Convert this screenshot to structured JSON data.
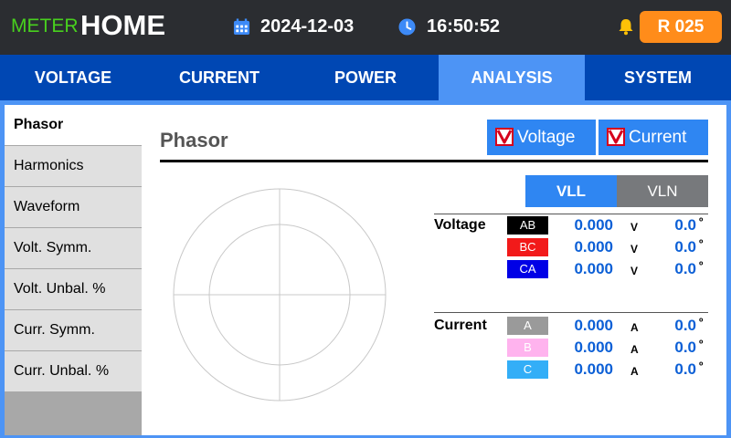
{
  "header": {
    "brand_small": "METER",
    "brand_large": "HOME",
    "date": "2024-12-03",
    "time": "16:50:52",
    "badge": "R 025",
    "icons": [
      "calendar-icon",
      "clock-icon",
      "bell-icon"
    ],
    "colors": {
      "bar": "#2b2d31",
      "brand_small": "#48d01e",
      "badge": "#ff8c1a",
      "bell": "#ffc107"
    }
  },
  "tabs": [
    {
      "label": "VOLTAGE",
      "active": false
    },
    {
      "label": "CURRENT",
      "active": false
    },
    {
      "label": "POWER",
      "active": false
    },
    {
      "label": "ANALYSIS",
      "active": true
    },
    {
      "label": "SYSTEM",
      "active": false
    }
  ],
  "sidebar": {
    "items": [
      {
        "label": "Phasor",
        "active": true
      },
      {
        "label": "Harmonics",
        "active": false
      },
      {
        "label": "Waveform",
        "active": false
      },
      {
        "label": "Volt. Symm.",
        "active": false
      },
      {
        "label": "Volt. Unbal. %",
        "active": false
      },
      {
        "label": "Curr. Symm.",
        "active": false
      },
      {
        "label": "Curr. Unbal. %",
        "active": false
      }
    ]
  },
  "panel": {
    "title": "Phasor",
    "checkboxes": [
      {
        "label": "Voltage",
        "checked": true
      },
      {
        "label": "Current",
        "checked": true
      }
    ],
    "toggle": {
      "options": [
        "VLL",
        "VLN"
      ],
      "selected": "VLL"
    },
    "groups": {
      "voltage": {
        "label": "Voltage",
        "rows": [
          {
            "phase": "AB",
            "value": "0.000",
            "unit": "V",
            "angle": "0.0",
            "angle_unit": "º",
            "chip_color": "#000000",
            "text_color": "#ffffff"
          },
          {
            "phase": "BC",
            "value": "0.000",
            "unit": "V",
            "angle": "0.0",
            "angle_unit": "º",
            "chip_color": "#f21a1a",
            "text_color": "#ffffff"
          },
          {
            "phase": "CA",
            "value": "0.000",
            "unit": "V",
            "angle": "0.0",
            "angle_unit": "º",
            "chip_color": "#0000e6",
            "text_color": "#ffffff"
          }
        ]
      },
      "current": {
        "label": "Current",
        "rows": [
          {
            "phase": "A",
            "value": "0.000",
            "unit": "A",
            "angle": "0.0",
            "angle_unit": "º",
            "chip_color": "#9a9a9a",
            "text_color": "#ffffff"
          },
          {
            "phase": "B",
            "value": "0.000",
            "unit": "A",
            "angle": "0.0",
            "angle_unit": "º",
            "chip_color": "#ffb3ee",
            "text_color": "#ffffff"
          },
          {
            "phase": "C",
            "value": "0.000",
            "unit": "A",
            "angle": "0.0",
            "angle_unit": "º",
            "chip_color": "#33aef7",
            "text_color": "#ffffff"
          }
        ]
      }
    }
  }
}
